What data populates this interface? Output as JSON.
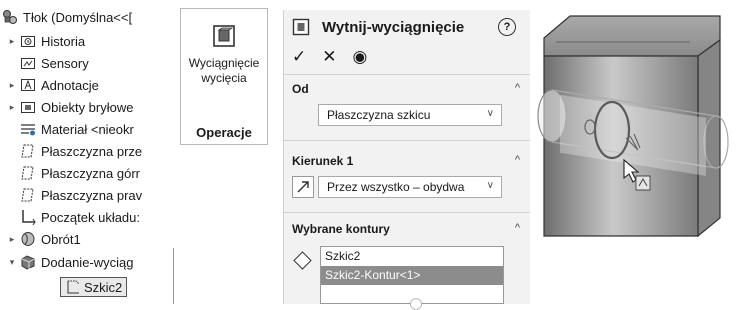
{
  "tree": {
    "root": "Tłok (Domyślna<<[",
    "items": [
      {
        "label": "Historia",
        "icon": "history-folder-icon",
        "expand": "▸"
      },
      {
        "label": "Sensory",
        "icon": "sensors-folder-icon",
        "expand": ""
      },
      {
        "label": "Adnotacje",
        "icon": "annotations-icon",
        "expand": "▸"
      },
      {
        "label": "Obiekty bryłowe",
        "icon": "solid-bodies-icon",
        "expand": "▸"
      },
      {
        "label": "Materiał <nieokr",
        "icon": "material-icon",
        "expand": ""
      },
      {
        "label": "Płaszczyzna prze",
        "icon": "plane-icon",
        "expand": ""
      },
      {
        "label": "Płaszczyzna górr",
        "icon": "plane-icon",
        "expand": ""
      },
      {
        "label": "Płaszczyzna prav",
        "icon": "plane-icon",
        "expand": ""
      },
      {
        "label": "Początek układu:",
        "icon": "origin-icon",
        "expand": ""
      },
      {
        "label": "Obrót1",
        "icon": "revolve-icon",
        "expand": "▸"
      },
      {
        "label": "Dodanie-wyciąg",
        "icon": "extrude-icon",
        "expand": "▾"
      },
      {
        "label": "Szkic2",
        "icon": "sketch-icon",
        "expand": ""
      }
    ]
  },
  "ribbon": {
    "button_label": "Wyciągnięcie wycięcia",
    "tab_label": "Operacje"
  },
  "pm": {
    "title": "Wytnij-wyciągnięcie",
    "help": "?",
    "ok": "✓",
    "cancel": "✕",
    "preview": "◉",
    "from": {
      "title": "Od",
      "value": "Płaszczyzna szkicu"
    },
    "direction1": {
      "title": "Kierunek 1",
      "value": "Przez wszystko – obydwa"
    },
    "contours": {
      "title": "Wybrane kontury",
      "items": [
        "Szkic2",
        "Szkic2-Kontur<1>"
      ],
      "selected_index": 1
    }
  },
  "colors": {
    "accent_select": "#8c8c8c",
    "panel_bg": "#f2f2f2",
    "model_gray": "#8e8e8e"
  }
}
